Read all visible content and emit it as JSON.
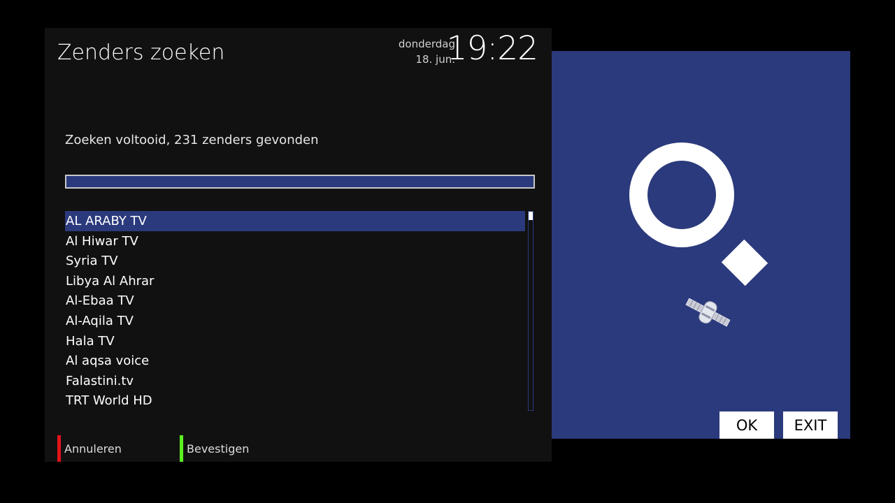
{
  "header": {
    "title": "Zenders zoeken",
    "day": "donderdag",
    "date": "18. jun.",
    "time": "19:22"
  },
  "scan": {
    "status": "Zoeken voltooid, 231 zenders gevonden",
    "progress": 1.0
  },
  "channels": [
    "AL ARABY TV",
    "Al Hiwar TV",
    "Syria TV",
    "Libya Al Ahrar",
    "Al-Ebaa TV",
    "Al-Aqila TV",
    "Hala TV",
    "Al aqsa voice",
    "Falastini.tv",
    "TRT World HD"
  ],
  "selected_index": 0,
  "footer": {
    "red_label": "Annuleren",
    "green_label": "Bevestigen"
  },
  "keys": {
    "ok_label": "OK",
    "exit_label": "EXIT"
  },
  "icons": {
    "search": "magnifier-icon",
    "satellite": "satellite-icon"
  },
  "colors": {
    "accent": "#2b3a7c",
    "red_key": "#e3141a",
    "green_key": "#5cf021",
    "panel": "#111111"
  }
}
